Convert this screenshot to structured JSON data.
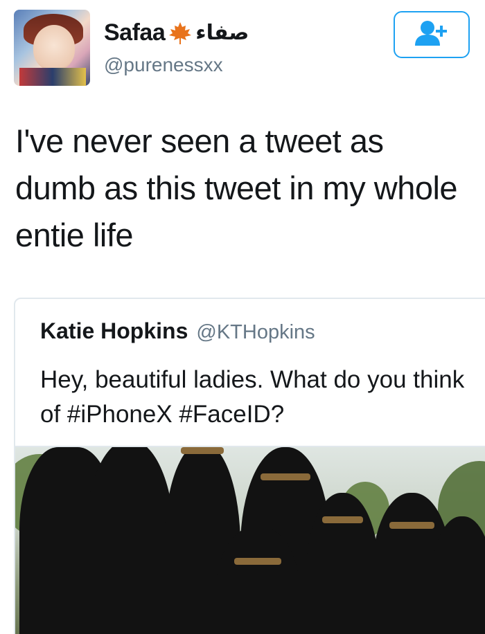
{
  "tweet": {
    "author": {
      "display_name": "Safaa",
      "arabic_name": "صفاء",
      "handle": "@purenessxx",
      "leaf_icon": "maple-leaf-icon"
    },
    "follow_button_icon": "add-user-icon",
    "text": "I've never seen a tweet as dumb as this tweet in my whole entie life"
  },
  "quoted_tweet": {
    "display_name": "Katie Hopkins",
    "handle": "@KTHopkins",
    "text": "Hey, beautiful ladies. What do you think of #iPhoneX #FaceID?"
  },
  "colors": {
    "accent": "#1da1f2",
    "text": "#14171a",
    "secondary": "#657786",
    "leaf": "#e8731c"
  }
}
